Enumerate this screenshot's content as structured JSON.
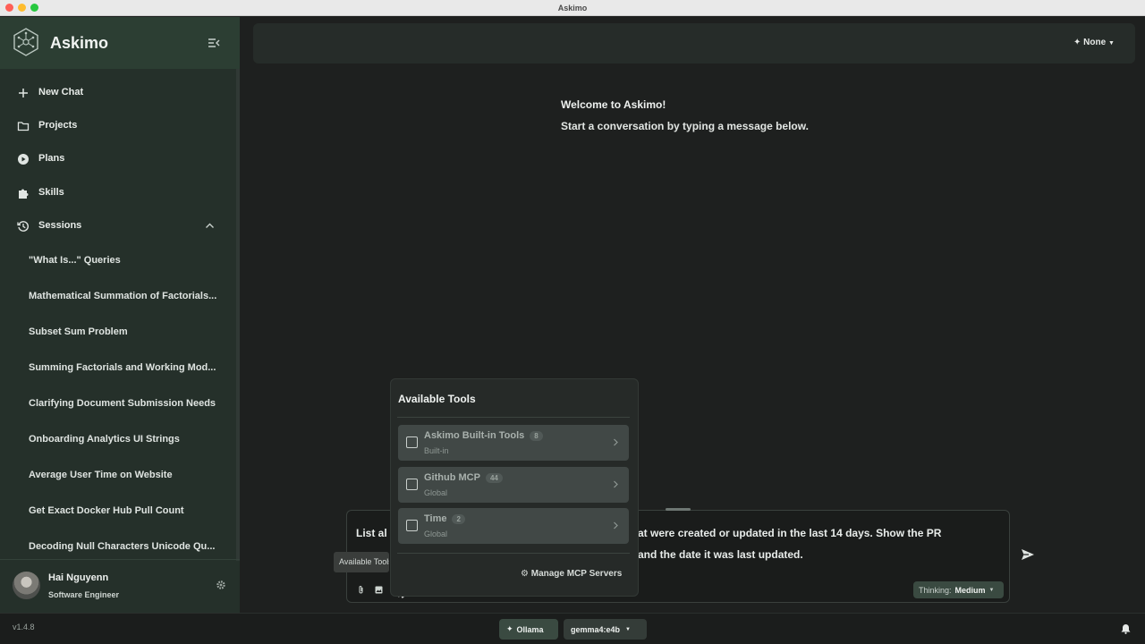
{
  "window": {
    "title": "Askimo"
  },
  "sidebar": {
    "app_name": "Askimo",
    "nav": [
      {
        "label": "New Chat",
        "icon": "plus-icon"
      },
      {
        "label": "Projects",
        "icon": "folder-icon"
      },
      {
        "label": "Plans",
        "icon": "play-circle-icon"
      },
      {
        "label": "Skills",
        "icon": "puzzle-icon"
      },
      {
        "label": "Sessions",
        "icon": "history-icon"
      }
    ],
    "sessions": [
      "\"What Is...\" Queries",
      "Mathematical Summation of Factorials...",
      "Subset Sum Problem",
      "Summing Factorials and Working Mod...",
      "Clarifying Document Submission Needs",
      "Onboarding Analytics UI Strings",
      "Average User Time on Website",
      "Get Exact Docker Hub Pull Count",
      "Decoding Null Characters Unicode Qu..."
    ],
    "user": {
      "name": "Hai Nguyenn",
      "role": "Software Engineer"
    }
  },
  "statusbar": {
    "version": "v1.4.8",
    "provider": "Ollama",
    "model": "gemma4:e4b"
  },
  "header": {
    "model_select": "None"
  },
  "welcome": {
    "title": "Welcome to Askimo!",
    "subtitle": "Start a conversation by typing a message below."
  },
  "composer": {
    "line1_start": "List al",
    "line1_end": "at were created or updated in the last 14 days. Show the PR",
    "line2_end": "and the date it was last updated.",
    "thinking_label": "Thinking:",
    "thinking_value": "Medium",
    "tooltip": "Available Tools"
  },
  "tools_popover": {
    "title": "Available Tools",
    "tools": [
      {
        "name": "Askimo Built-in Tools",
        "count": "8",
        "scope": "Built-in"
      },
      {
        "name": "Github MCP",
        "count": "44",
        "scope": "Global"
      },
      {
        "name": "Time",
        "count": "2",
        "scope": "Global"
      }
    ],
    "manage_label": "Manage MCP Servers"
  },
  "colors": {
    "sidebar_bg": "#25302a",
    "sidebar_header_bg": "#2c3e33",
    "accent_pill": "#3a4a41",
    "main_bg": "#1e201f"
  }
}
